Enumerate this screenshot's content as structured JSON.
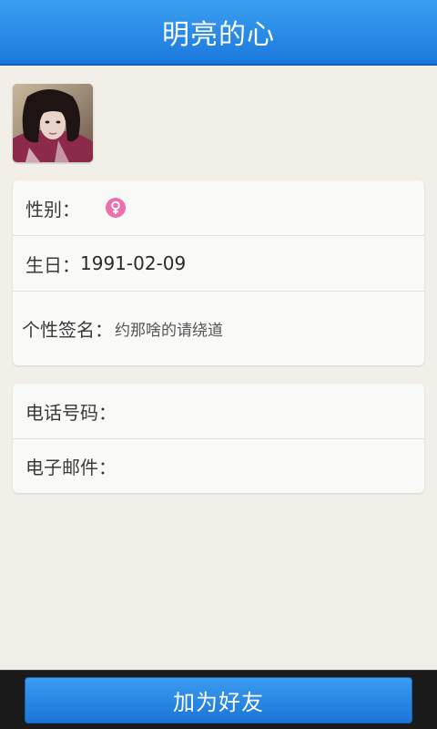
{
  "header": {
    "title": "明亮的心"
  },
  "profile": {
    "avatar_icon": "user-avatar-photo"
  },
  "info_card": {
    "gender_label": "性别：",
    "gender_icon": "female-symbol-icon",
    "gender_color": "#ee6fae",
    "birthday_label": "生日：",
    "birthday_value": "1991-02-09",
    "signature_label": "个性签名：",
    "signature_value": "约那啥的请绕道"
  },
  "contact_card": {
    "phone_label": "电话号码：",
    "phone_value": "",
    "email_label": "电子邮件：",
    "email_value": ""
  },
  "footer": {
    "add_friend_label": "加为好友"
  },
  "colors": {
    "accent": "#1c78dc",
    "background": "#f2efe8",
    "card": "#f9f9f8"
  }
}
